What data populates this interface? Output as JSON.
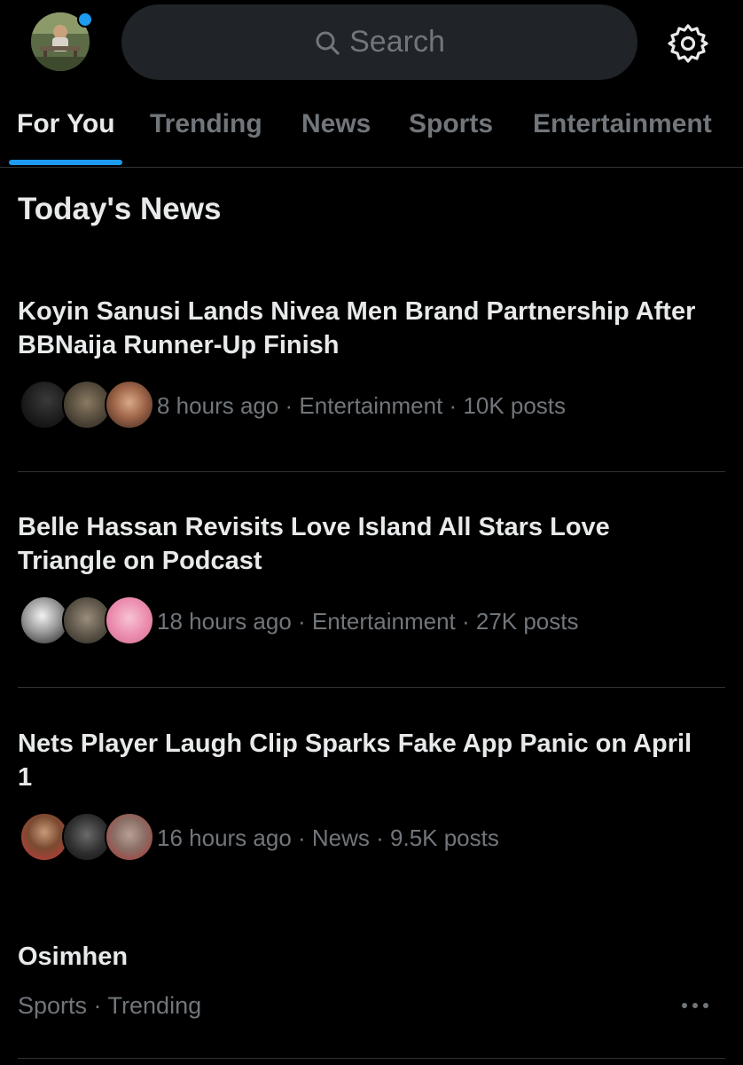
{
  "header": {
    "search_placeholder": "Search"
  },
  "tabs": [
    {
      "label": "For You",
      "active": true
    },
    {
      "label": "Trending",
      "active": false
    },
    {
      "label": "News",
      "active": false
    },
    {
      "label": "Sports",
      "active": false
    },
    {
      "label": "Entertainment",
      "active": false
    }
  ],
  "section_title": "Today's News",
  "news": [
    {
      "headline": "Koyin Sanusi Lands Nivea Men Brand Partnership After BBNaija Runner-Up Finish",
      "meta": "8 hours ago · Entertainment · 10K posts"
    },
    {
      "headline": "Belle Hassan Revisits Love Island All Stars Love Triangle on Podcast",
      "meta": "18 hours ago · Entertainment · 27K posts"
    },
    {
      "headline": "Nets Player Laugh Clip Sparks Fake App Panic on April 1",
      "meta": "16 hours ago · News · 9.5K posts"
    }
  ],
  "trend": {
    "name": "Osimhen",
    "meta": "Sports · Trending"
  },
  "colors": {
    "background": "#000000",
    "accent": "#1d9bf0",
    "text_primary": "#e7e9ea",
    "text_secondary": "#71767b",
    "divider": "#2f3336",
    "search_bg": "#202327"
  },
  "icons": {
    "search": "search-icon",
    "settings": "gear-icon",
    "more": "more-options-icon"
  }
}
